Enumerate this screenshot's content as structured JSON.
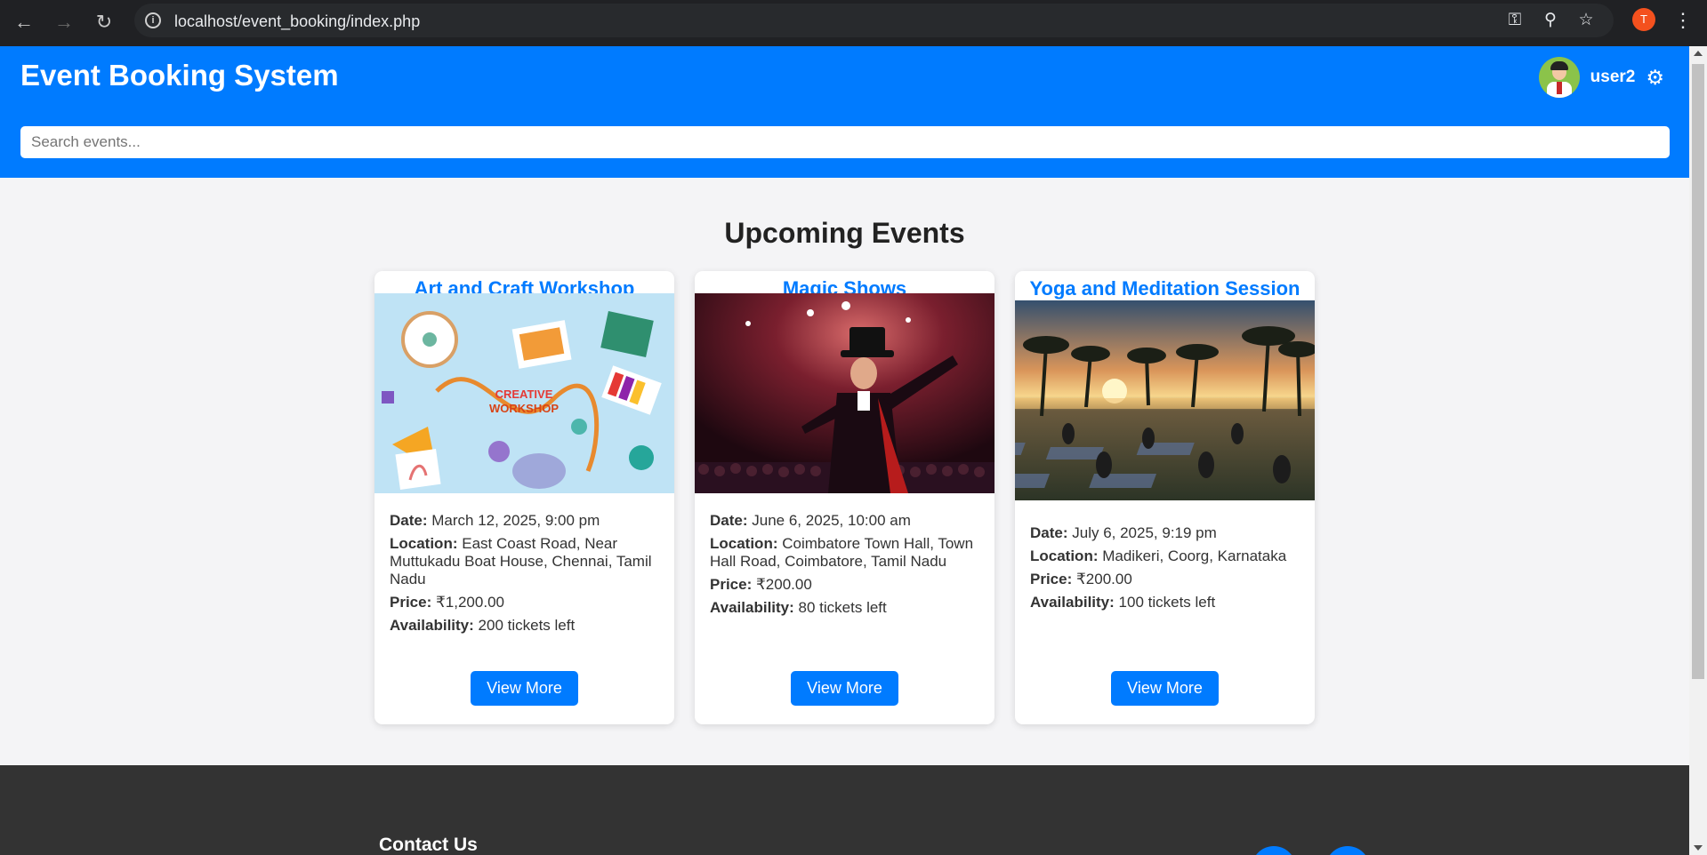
{
  "browser": {
    "url": "localhost/event_booking/index.php",
    "profile_initial": "T"
  },
  "header": {
    "site_title": "Event Booking System",
    "user_name": "user2",
    "search_placeholder": "Search events..."
  },
  "main": {
    "section_title": "Upcoming Events",
    "events": [
      {
        "title": "Art and Craft Workshop",
        "date_label": "Date:",
        "date": "March 12, 2025, 9:00 pm",
        "location_label": "Location:",
        "location": "East Coast Road, Near Muttukadu Boat House, Chennai, Tamil Nadu",
        "price_label": "Price:",
        "price": "₹1,200.00",
        "availability_label": "Availability:",
        "availability": "200 tickets left",
        "button": "View More",
        "image_text": "CREATIVE WORKSHOP"
      },
      {
        "title": "Magic Shows",
        "date_label": "Date:",
        "date": "June 6, 2025, 10:00 am",
        "location_label": "Location:",
        "location": "Coimbatore Town Hall, Town Hall Road, Coimbatore, Tamil Nadu",
        "price_label": "Price:",
        "price": "₹200.00",
        "availability_label": "Availability:",
        "availability": "80 tickets left",
        "button": "View More"
      },
      {
        "title": "Yoga and Meditation Session",
        "date_label": "Date:",
        "date": "July 6, 2025, 9:19 pm",
        "location_label": "Location:",
        "location": "Madikeri, Coorg, Karnataka",
        "price_label": "Price:",
        "price": "₹200.00",
        "availability_label": "Availability:",
        "availability": "100 tickets left",
        "button": "View More"
      }
    ]
  },
  "footer": {
    "contact_title": "Contact Us"
  },
  "colors": {
    "primary": "#007bff",
    "footer_bg": "#333333",
    "page_bg": "#f4f4f6"
  }
}
